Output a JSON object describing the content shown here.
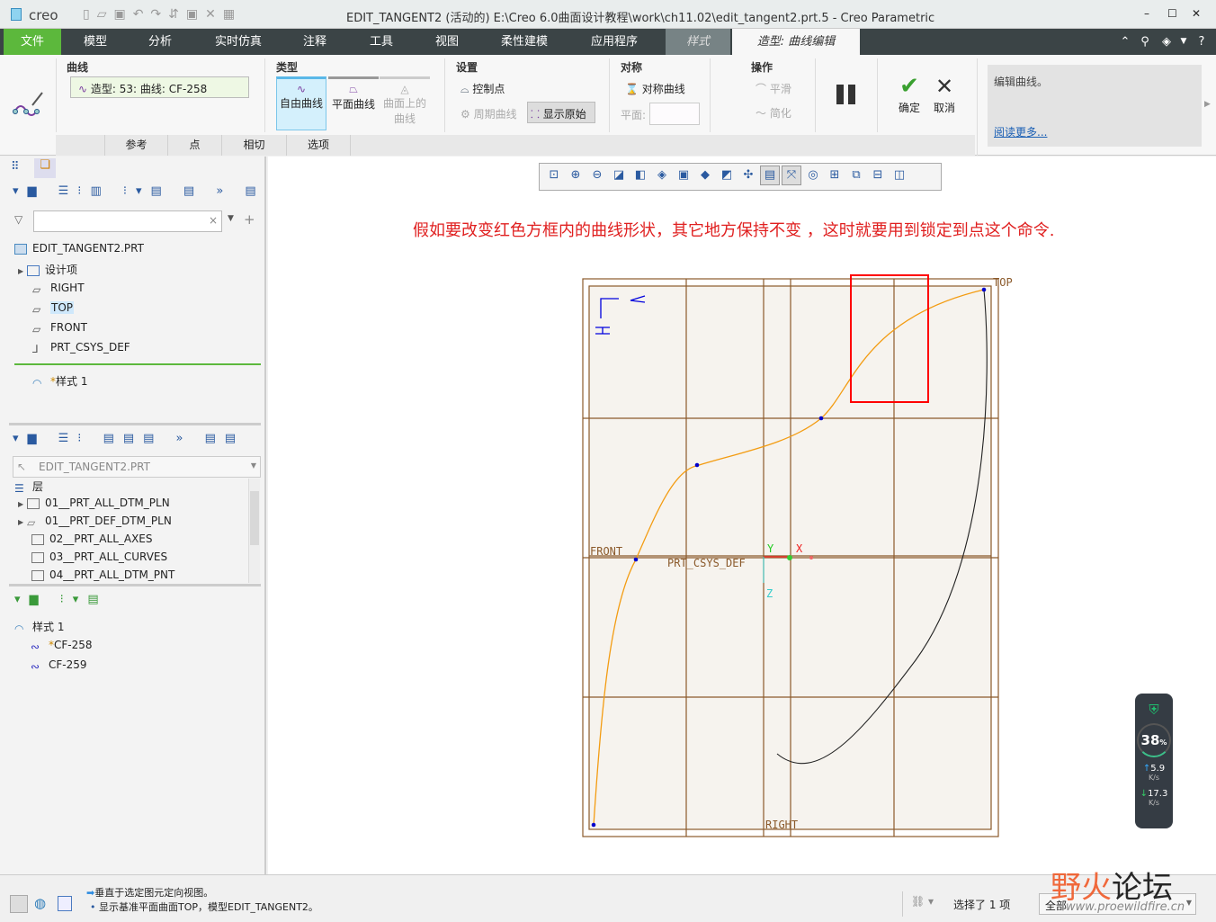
{
  "titlebar": {
    "logo": "creo",
    "title": "EDIT_TANGENT2 (活动的) E:\\Creo 6.0曲面设计教程\\work\\ch11.02\\edit_tangent2.prt.5 - Creo Parametric",
    "min": "–",
    "max": "☐",
    "close": "✕"
  },
  "menu": {
    "items": [
      "文件",
      "模型",
      "分析",
      "实时仿真",
      "注释",
      "工具",
      "视图",
      "柔性建模",
      "应用程序",
      "样式",
      "造型: 曲线编辑"
    ],
    "right_icons": [
      "collapse-ribbon-icon",
      "search-icon",
      "graduation-cap-icon",
      "dropdown-icon",
      "help-icon"
    ],
    "help": "?"
  },
  "ribbon": {
    "curve": {
      "label": "曲线",
      "value": "造型: 53: 曲线: CF-258"
    },
    "type": {
      "label": "类型",
      "free": "自由曲线",
      "planar": "平面曲线",
      "on_surface": "曲面上的",
      "on_surface2": "曲线"
    },
    "settings": {
      "label": "设置",
      "control_points": "控制点",
      "periodic": "周期曲线",
      "show_original": "显示原始"
    },
    "symmetry": {
      "label": "对称",
      "sym_curve": "对称曲线",
      "plane_label": "平面:",
      "plane_value": ""
    },
    "ops": {
      "label": "操作",
      "smooth": "平滑",
      "simplify": "简化"
    },
    "ok": "确定",
    "cancel": "取消",
    "help": {
      "text": "编辑曲线。",
      "link": "阅读更多..."
    },
    "subtabs": [
      "参考",
      "点",
      "相切",
      "选项"
    ]
  },
  "model_tree": {
    "filter_placeholder": "",
    "root": "EDIT_TANGENT2.PRT",
    "items": [
      "设计项",
      "RIGHT",
      "TOP",
      "FRONT",
      "PRT_CSYS_DEF"
    ],
    "style": "样式 1"
  },
  "layers": {
    "select": "EDIT_TANGENT2.PRT",
    "header": "层",
    "items": [
      "01__PRT_ALL_DTM_PLN",
      "01__PRT_DEF_DTM_PLN",
      "02__PRT_ALL_AXES",
      "03__PRT_ALL_CURVES",
      "04__PRT_ALL_DTM_PNT"
    ]
  },
  "style_tree": {
    "root": "样式 1",
    "items": [
      "CF-258",
      "CF-259"
    ]
  },
  "canvas": {
    "annotation": "假如要改变红色方框内的曲线形状，其它地方保持不变 ，这时就要用到锁定到点这个命令.",
    "labels": {
      "top": "TOP",
      "front": "FRONT",
      "right": "RIGHT",
      "csys": "PRT_CSYS_DEF",
      "x": "X",
      "y": "Y",
      "z": "Z"
    },
    "colors": {
      "curve": "#f39c12",
      "plane": "#8b5a2b",
      "highlight": "#ff0000",
      "points": "#0000cc"
    }
  },
  "netmeter": {
    "percent": "38",
    "unit": "%",
    "up": "5.9",
    "down": "17.3",
    "rate_unit": "K/s"
  },
  "status": {
    "msg1": "垂直于选定图元定向视图。",
    "msg2": "显示基准平面曲面TOP，模型EDIT_TANGENT2。",
    "selected": "选择了 1 项",
    "filter": "全部"
  },
  "watermark": {
    "text": "野火论坛",
    "url": "www.proewildfire.cn"
  }
}
